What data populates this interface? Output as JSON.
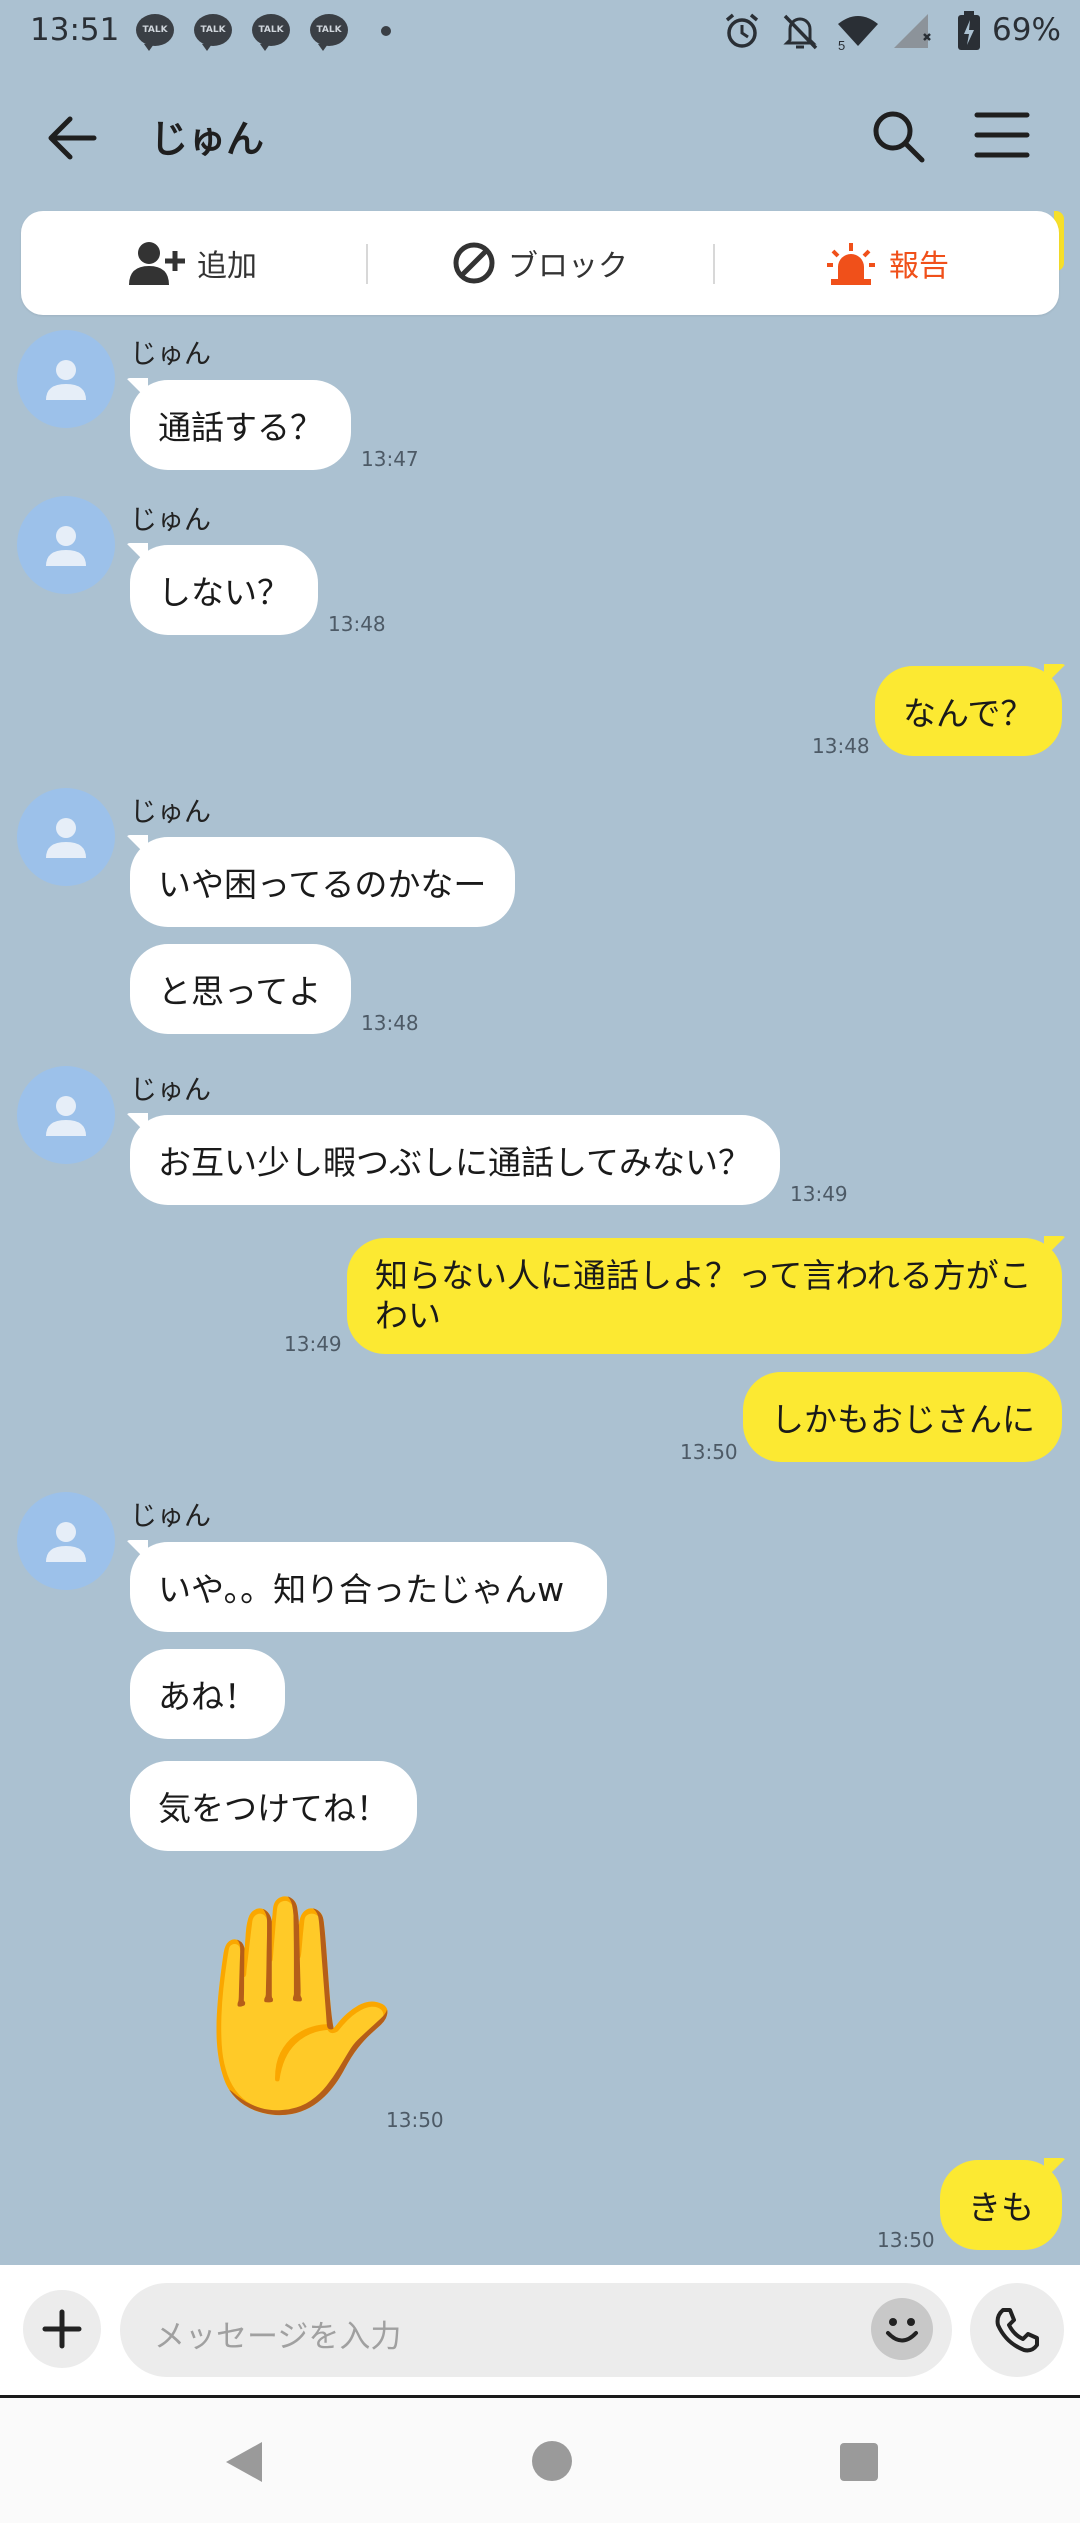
{
  "status_bar": {
    "time": "13:51",
    "talk_badges": [
      "TALK",
      "TALK",
      "TALK",
      "TALK"
    ],
    "icons": [
      "alarm-icon",
      "mute-icon",
      "wifi-icon",
      "signal-icon",
      "battery-icon"
    ],
    "wifi_sub": "5",
    "battery": "69%"
  },
  "header": {
    "title": "じゅん"
  },
  "actions": {
    "add": "追加",
    "block": "ブロック",
    "report": "報告"
  },
  "messages": [
    {
      "sender": "other",
      "name": "じゅん",
      "text": "通話する？",
      "time": "13:47"
    },
    {
      "sender": "other",
      "name": "じゅん",
      "text": "しない？",
      "time": "13:48"
    },
    {
      "sender": "me",
      "text": "なんで？",
      "time": "13:48"
    },
    {
      "sender": "other",
      "name": "じゅん",
      "text": "いや困ってるのかなー"
    },
    {
      "sender": "other",
      "text": "と思ってよ",
      "time": "13:48"
    },
    {
      "sender": "other",
      "name": "じゅん",
      "text": "お互い少し暇つぶしに通話してみない？",
      "time": "13:49"
    },
    {
      "sender": "me",
      "text": "知らない人に通話しよ？って言われる方がこわい",
      "time": "13:49"
    },
    {
      "sender": "me",
      "text": "しかもおじさんに",
      "time": "13:50"
    },
    {
      "sender": "other",
      "name": "じゅん",
      "text": "いや。。知り合ったじゃんw"
    },
    {
      "sender": "other",
      "text": "あね！"
    },
    {
      "sender": "other",
      "text": "気をつけてね！"
    },
    {
      "sender": "other",
      "sticker": "✋",
      "time": "13:50"
    },
    {
      "sender": "me",
      "text": "きも",
      "time": "13:50"
    }
  ],
  "input": {
    "placeholder": "メッセージを入力"
  },
  "colors": {
    "background": "#abc1d1",
    "my_bubble": "#fce932",
    "their_bubble": "#ffffff",
    "report": "#f0501a"
  }
}
